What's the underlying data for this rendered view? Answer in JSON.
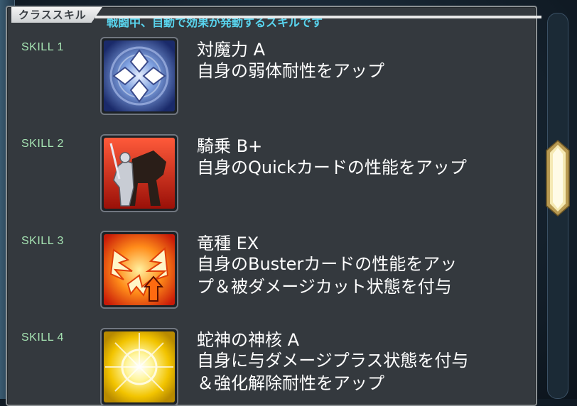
{
  "panel": {
    "tab_title": "クラススキル",
    "subtitle": "戦闘中、自動で効果が発動するスキルです"
  },
  "skills": [
    {
      "label": "SKILL 1",
      "name": "対魔力 A",
      "desc_lines": [
        "自身の弱体耐性をアップ"
      ],
      "icon": "magic-resistance-icon"
    },
    {
      "label": "SKILL 2",
      "name": "騎乗 B+",
      "desc_lines": [
        "自身のQuickカードの性能をアップ"
      ],
      "icon": "riding-icon"
    },
    {
      "label": "SKILL 3",
      "name": "竜種 EX",
      "desc_lines": [
        "自身のBusterカードの性能をアッ",
        "プ＆被ダメージカット状態を付与"
      ],
      "icon": "dragon-kind-icon"
    },
    {
      "label": "SKILL 4",
      "name": "蛇神の神核 A",
      "desc_lines": [
        "自身に与ダメージプラス状態を付与",
        "＆強化解除耐性をアップ"
      ],
      "icon": "divine-core-icon"
    }
  ],
  "colors": {
    "panel_bg": "#34393e",
    "subtitle": "#59d4ee",
    "skill_label": "#a6e4b3",
    "text": "#ffffff",
    "scroll_thumb": "#f5e9b3"
  }
}
